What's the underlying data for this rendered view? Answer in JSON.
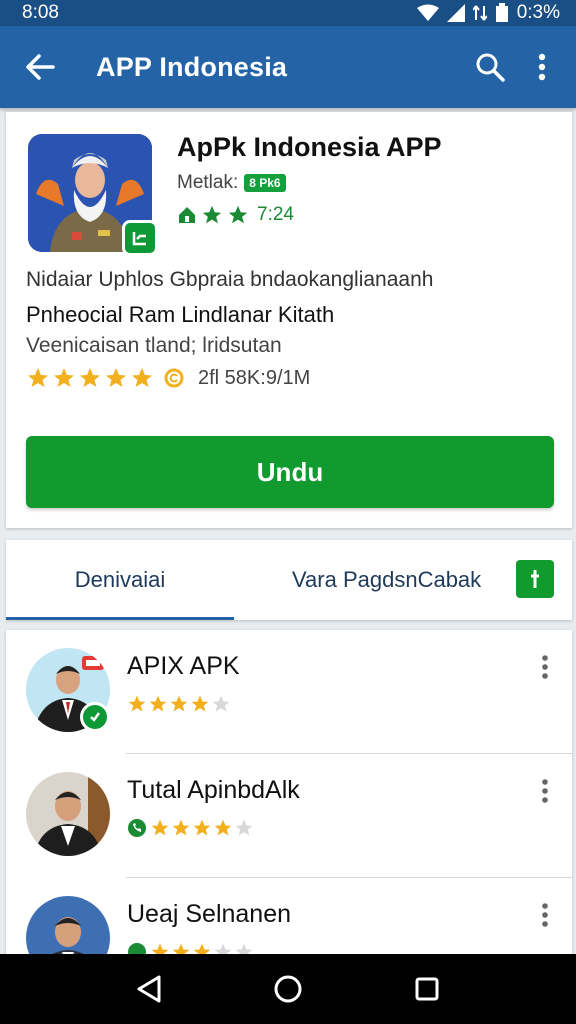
{
  "status_bar": {
    "time": "8:08",
    "battery": "0:3%"
  },
  "app_bar": {
    "title": "APP Indonesia",
    "icons": [
      "back-arrow-icon",
      "search-icon",
      "more-vert-icon"
    ]
  },
  "app_card": {
    "name": "ApPk Indonesia APP",
    "meta_label": "Metlak:",
    "meta_badge": "8 Pk6",
    "info_text": "7:24",
    "description_1": "Nidaiar Uphlos Gbpraia bndaokanglianaanh",
    "description_2": "Pnheocial Ram Lindlanar Kitath",
    "description_3": "Veenicaisan tland; lridsutan",
    "rating_stars": 5,
    "rating_text": "2fl 58K:9/1M",
    "install_label": "Undu"
  },
  "tabs": {
    "active": "Denivaiai",
    "other": "Vara PagdsnCabak"
  },
  "list_items": [
    {
      "title": "APIX APK",
      "rating": 4
    },
    {
      "title": "Tutal ApinbdAlk",
      "rating": 4
    },
    {
      "title": "Ueaj Selnanen",
      "rating": 3
    }
  ],
  "colors": {
    "primary": "#2464a6",
    "status_bar": "#1a4f85",
    "accent_green": "#119a2e",
    "star": "#f2b01e",
    "background": "#e9ecef"
  },
  "nav_icons": [
    "back-triangle-icon",
    "home-circle-icon",
    "recents-square-icon"
  ]
}
